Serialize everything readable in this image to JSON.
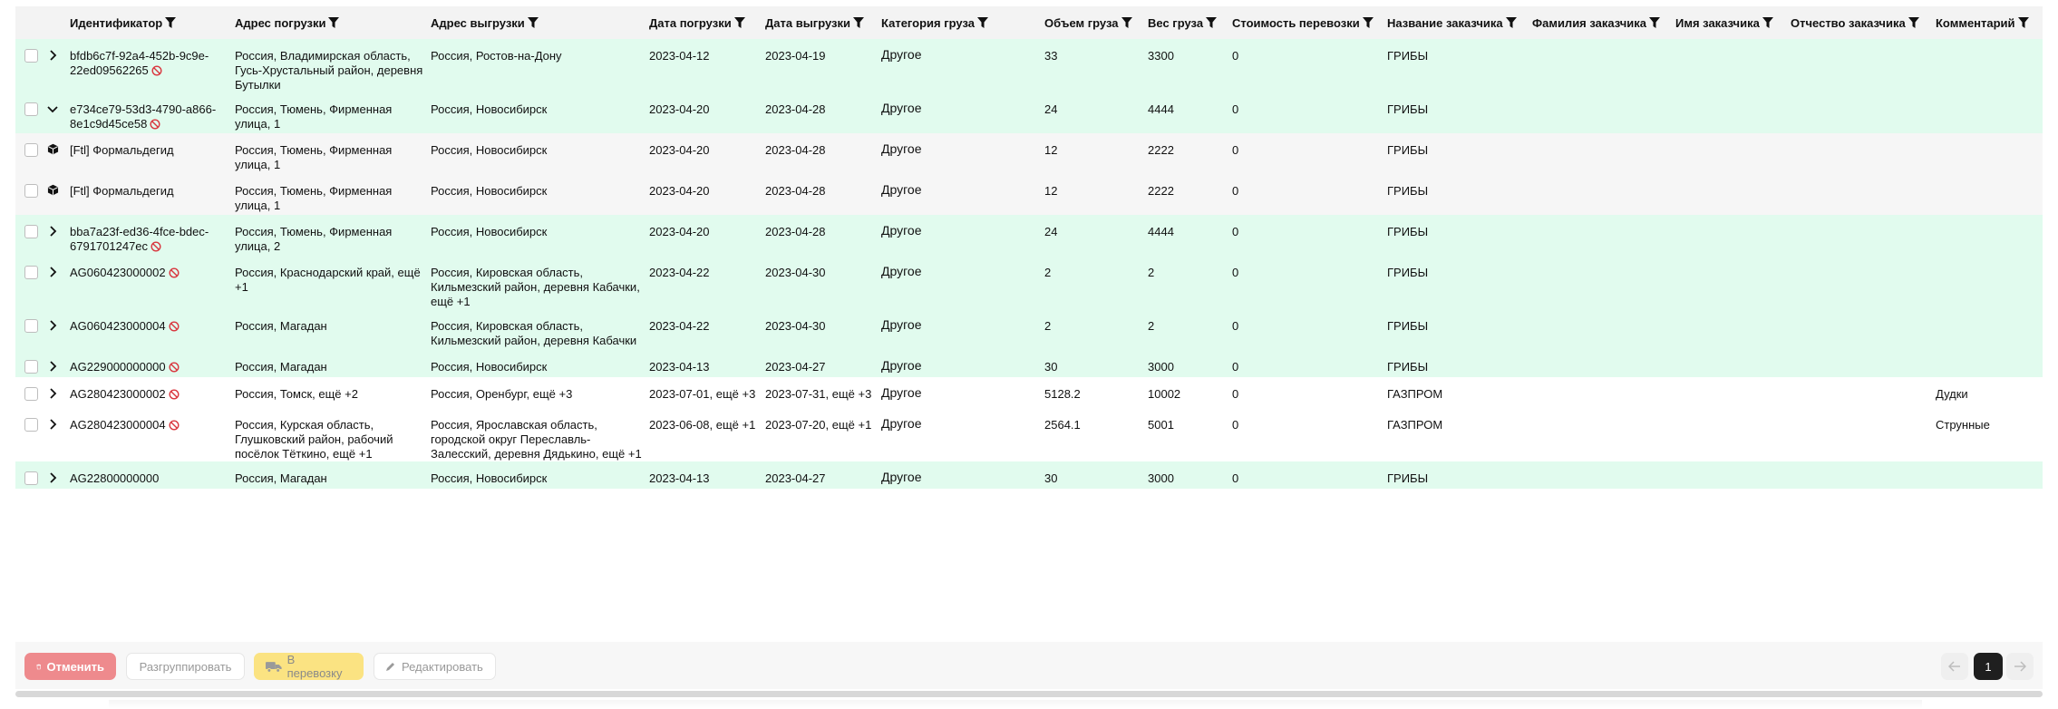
{
  "table": {
    "headers": [
      {
        "label": ""
      },
      {
        "label": ""
      },
      {
        "label": "Идентификатор"
      },
      {
        "label": "Адрес погрузки"
      },
      {
        "label": "Адрес выгрузки"
      },
      {
        "label": "Дата погрузки"
      },
      {
        "label": "Дата выгрузки"
      },
      {
        "label": "Категория груза"
      },
      {
        "label": "Объем груза"
      },
      {
        "label": "Вес груза"
      },
      {
        "label": "Стоимость перевозки"
      },
      {
        "label": "Название заказчика"
      },
      {
        "label": "Фамилия заказчика"
      },
      {
        "label": "Имя заказчика"
      },
      {
        "label": "Отчество заказчика"
      },
      {
        "label": "Комментарий"
      }
    ],
    "rows": [
      {
        "toggle": "chevron-right",
        "color": "green",
        "id": "bfdb6c7f-92a4-452b-9c9e-22ed09562265",
        "blocked": true,
        "load_addr": "Россия, Владимирская область, Гусь-Хрустальный район, деревня Бутылки",
        "unload_addr": "Россия, Ростов-на-Дону",
        "load_date": "2023-04-12",
        "unload_date": "2023-04-19",
        "category": "Другое",
        "volume": "33",
        "weight": "3300",
        "cost": "0",
        "customer": "ГРИБЫ",
        "last_name": "",
        "first_name": "",
        "middle_name": "",
        "comment": ""
      },
      {
        "toggle": "chevron-down",
        "color": "green",
        "id": "e734ce79-53d3-4790-a866-8e1c9d45ce58",
        "blocked": true,
        "load_addr": "Россия, Тюмень, Фирменная улица, 1",
        "unload_addr": "Россия, Новосибирск",
        "load_date": "2023-04-20",
        "unload_date": "2023-04-28",
        "category": "Другое",
        "volume": "24",
        "weight": "4444",
        "cost": "0",
        "customer": "ГРИБЫ",
        "last_name": "",
        "first_name": "",
        "middle_name": "",
        "comment": ""
      },
      {
        "toggle": "cube",
        "color": "gray",
        "id": "[Ftl] Формальдегид",
        "blocked": false,
        "load_addr": "Россия, Тюмень, Фирменная улица, 1",
        "unload_addr": "Россия, Новосибирск",
        "load_date": "2023-04-20",
        "unload_date": "2023-04-28",
        "category": "Другое",
        "volume": "12",
        "weight": "2222",
        "cost": "0",
        "customer": "ГРИБЫ",
        "last_name": "",
        "first_name": "",
        "middle_name": "",
        "comment": ""
      },
      {
        "toggle": "cube",
        "color": "gray",
        "id": "[Ftl] Формальдегид",
        "blocked": false,
        "load_addr": "Россия, Тюмень, Фирменная улица, 1",
        "unload_addr": "Россия, Новосибирск",
        "load_date": "2023-04-20",
        "unload_date": "2023-04-28",
        "category": "Другое",
        "volume": "12",
        "weight": "2222",
        "cost": "0",
        "customer": "ГРИБЫ",
        "last_name": "",
        "first_name": "",
        "middle_name": "",
        "comment": ""
      },
      {
        "toggle": "chevron-right",
        "color": "green",
        "id": "bba7a23f-ed36-4fce-bdec-6791701247ec",
        "blocked": true,
        "load_addr": "Россия, Тюмень, Фирменная улица, 2",
        "unload_addr": "Россия, Новосибирск",
        "load_date": "2023-04-20",
        "unload_date": "2023-04-28",
        "category": "Другое",
        "volume": "24",
        "weight": "4444",
        "cost": "0",
        "customer": "ГРИБЫ",
        "last_name": "",
        "first_name": "",
        "middle_name": "",
        "comment": ""
      },
      {
        "toggle": "chevron-right",
        "color": "green",
        "id": "AG060423000002",
        "blocked": true,
        "load_addr": "Россия, Краснодарский край, ещё +1",
        "unload_addr": "Россия, Кировская область, Кильмезский район, деревня Кабачки, ещё +1",
        "load_date": "2023-04-22",
        "unload_date": "2023-04-30",
        "category": "Другое",
        "volume": "2",
        "weight": "2",
        "cost": "0",
        "customer": "ГРИБЫ",
        "last_name": "",
        "first_name": "",
        "middle_name": "",
        "comment": ""
      },
      {
        "toggle": "chevron-right",
        "color": "green",
        "id": "AG060423000004",
        "blocked": true,
        "load_addr": "Россия, Магадан",
        "unload_addr": "Россия, Кировская область, Кильмезский район, деревня Кабачки",
        "load_date": "2023-04-22",
        "unload_date": "2023-04-30",
        "category": "Другое",
        "volume": "2",
        "weight": "2",
        "cost": "0",
        "customer": "ГРИБЫ",
        "last_name": "",
        "first_name": "",
        "middle_name": "",
        "comment": ""
      },
      {
        "toggle": "chevron-right",
        "color": "green",
        "id": "AG229000000000",
        "blocked": true,
        "load_addr": "Россия, Магадан",
        "unload_addr": "Россия, Новосибирск",
        "load_date": "2023-04-13",
        "unload_date": "2023-04-27",
        "category": "Другое",
        "volume": "30",
        "weight": "3000",
        "cost": "0",
        "customer": "ГРИБЫ",
        "last_name": "",
        "first_name": "",
        "middle_name": "",
        "comment": ""
      },
      {
        "toggle": "chevron-right",
        "color": "white",
        "id": "AG280423000002",
        "blocked": true,
        "load_addr": "Россия, Томск, ещё +2",
        "unload_addr": "Россия, Оренбург, ещё +3",
        "load_date": "2023-07-01, ещё +3",
        "unload_date": "2023-07-31, ещё +3",
        "category": "Другое",
        "volume": "5128.2",
        "weight": "10002",
        "cost": "0",
        "customer": "ГАЗПРОМ",
        "last_name": "",
        "first_name": "",
        "middle_name": "",
        "comment": "Дудки"
      },
      {
        "toggle": "chevron-right",
        "color": "white",
        "id": "AG280423000004",
        "blocked": true,
        "load_addr": "Россия, Курская область, Глушковский район, рабочий посёлок Тёткино, ещё +1",
        "unload_addr": "Россия, Ярославская область, городской округ Переславль-Залесский, деревня Дядькино, ещё +1",
        "load_date": "2023-06-08, ещё +1",
        "unload_date": "2023-07-20, ещё +1",
        "category": "Другое",
        "volume": "2564.1",
        "weight": "5001",
        "cost": "0",
        "customer": "ГАЗПРОМ",
        "last_name": "",
        "first_name": "",
        "middle_name": "",
        "comment": "Струнные"
      },
      {
        "toggle": "chevron-right",
        "color": "green",
        "id": "AG22800000000",
        "blocked": false,
        "load_addr": "Россия, Магадан",
        "unload_addr": "Россия, Новосибирск",
        "load_date": "2023-04-13",
        "unload_date": "2023-04-27",
        "category": "Другое",
        "volume": "30",
        "weight": "3000",
        "cost": "0",
        "customer": "ГРИБЫ",
        "last_name": "",
        "first_name": "",
        "middle_name": "",
        "comment": ""
      }
    ]
  },
  "footer": {
    "cancel_label": "Отменить",
    "ungroup_label": "Разгруппировать",
    "transport_label": "В перевозку",
    "edit_label": "Редактировать",
    "current_page": "1"
  },
  "colors": {
    "row_green": "#e1fbee",
    "row_gray": "#f6f6f6",
    "cancel_red": "#ee8a8d",
    "transport_yellow": "#fbe382",
    "blocked_icon": "#d9363e"
  }
}
